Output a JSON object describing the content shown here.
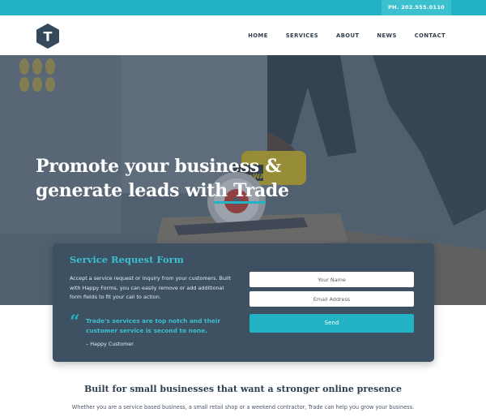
{
  "colors": {
    "accent": "#22b2c4",
    "dark": "#2f3d4c",
    "card": "#3d5163"
  },
  "topbar": {
    "phone": "PH. 202.555.0110"
  },
  "header": {
    "logo_letter": "T",
    "logo_icon": "hexagon-logo-icon",
    "nav": [
      "HOME",
      "SERVICES",
      "ABOUT",
      "NEWS",
      "CONTACT"
    ]
  },
  "hero": {
    "title_line1": "Promote your business &",
    "title_line2": "generate leads with Trade",
    "saw_brand": "DeWALT"
  },
  "form": {
    "title": "Service Request Form",
    "description": "Accept a service request or inquiry from your customers. Built with Happy Forms, you can easily remove or add additional form fields to fit your call to action.",
    "quote_icon": "quote-icon",
    "quote": "Trade's services are top notch and their customer service is second to none.",
    "quote_author": "– Happy Customer",
    "name_placeholder": "Your Name",
    "email_placeholder": "Email Address",
    "send_label": "Send"
  },
  "section": {
    "title": "Built for small businesses that want a stronger online presence",
    "text": "Whether you are a service based business, a small retail shop or a weekend contractor, Trade can help you grow your business."
  }
}
